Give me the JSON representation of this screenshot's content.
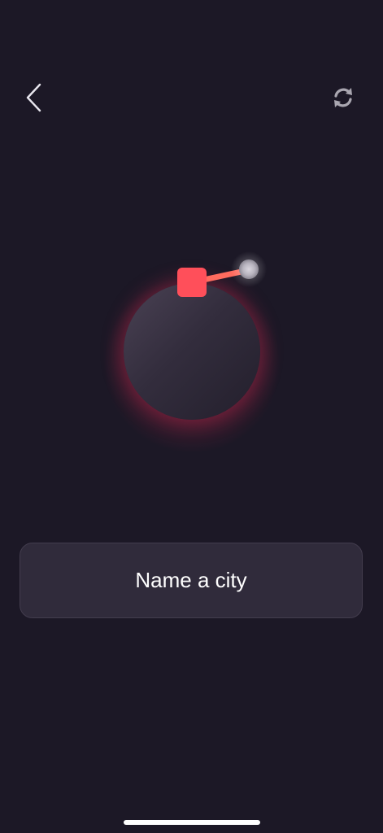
{
  "game": {
    "prompt_text": "Name a city"
  },
  "icons": {
    "back": "chevron-left-icon",
    "refresh": "refresh-icon",
    "bomb": "bomb-icon"
  },
  "colors": {
    "background": "#1c1826",
    "input_background": "#302b3b",
    "bomb_accent": "#ff4f5a",
    "fuse": "#ff6b5e",
    "glow": "#dc2850"
  }
}
